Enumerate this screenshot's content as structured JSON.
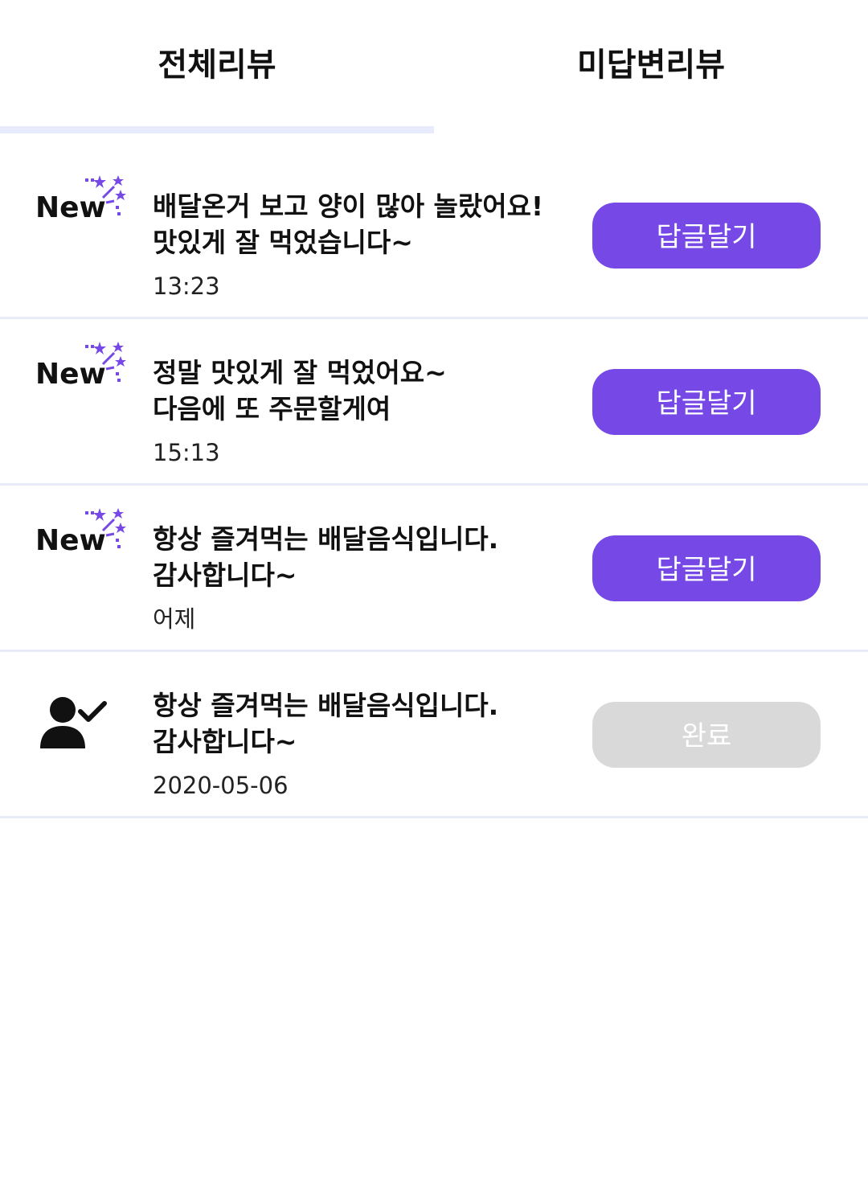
{
  "tabs": [
    {
      "label": "전체리뷰",
      "active": true
    },
    {
      "label": "미답변리뷰",
      "active": false
    }
  ],
  "colors": {
    "accent": "#7649e6",
    "indicator": "#e8ebfc",
    "done_button": "#d9d9d9"
  },
  "reviews": [
    {
      "badge": "New",
      "badge_icon": "sparkle-icon",
      "message": "배달온거 보고 양이 많아 놀랐어요!\n맛있게 잘 먹었습니다~",
      "time": "13:23",
      "button": "답글달기",
      "answered": false
    },
    {
      "badge": "New",
      "badge_icon": "sparkle-icon",
      "message": "정말 맛있게 잘 먹었어요~\n다음에 또 주문할게여",
      "time": "15:13",
      "button": "답글달기",
      "answered": false
    },
    {
      "badge": "New",
      "badge_icon": "sparkle-icon",
      "message": "항상 즐겨먹는 배달음식입니다.\n감사합니다~",
      "time": "어제",
      "button": "답글달기",
      "answered": false
    },
    {
      "badge": "",
      "badge_icon": "user-check-icon",
      "message": "항상 즐겨먹는 배달음식입니다.\n감사합니다~",
      "time": "2020-05-06",
      "button": "완료",
      "answered": true
    }
  ]
}
